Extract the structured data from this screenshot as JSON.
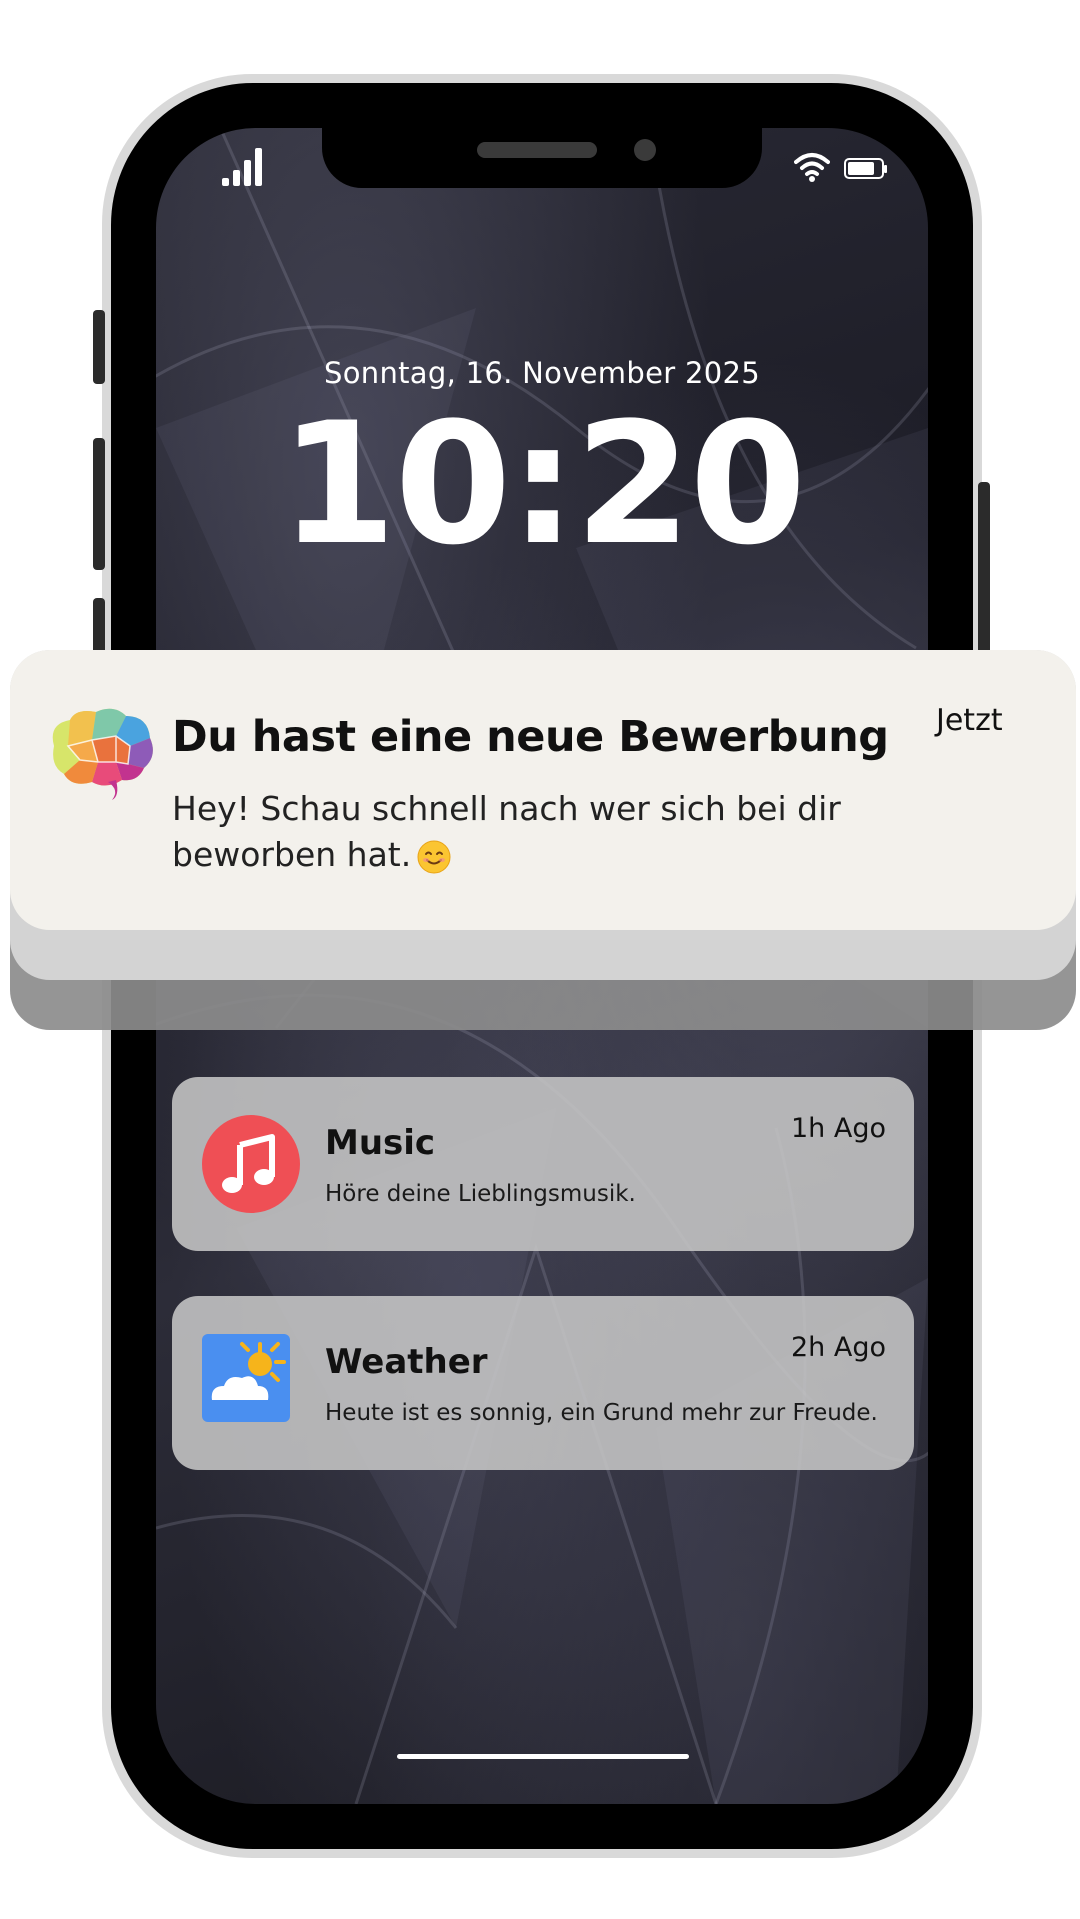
{
  "status_bar": {
    "signal_icon": "cellular-signal-icon",
    "wifi_icon": "wifi-icon",
    "battery_icon": "battery-icon"
  },
  "lock_screen": {
    "date": "Sonntag, 16. November 2025",
    "time": "10:20"
  },
  "main_notification": {
    "app_icon": "brain-logo-icon",
    "title": "Du hast eine neue Bewerbung",
    "time": "Jetzt",
    "body": "Hey! Schau schnell nach wer sich bei dir beworben hat.",
    "emoji": "smiling-face-icon"
  },
  "notifications": [
    {
      "app": "Music",
      "icon": "music-note-icon",
      "text": "Höre deine Lieblingsmusik.",
      "time": "1h Ago"
    },
    {
      "app": "Weather",
      "icon": "sun-cloud-icon",
      "text": "Heute ist es sonnig, ein Grund mehr zur Freude.",
      "time": "2h Ago"
    }
  ],
  "colors": {
    "music_icon_bg": "#ef4f55",
    "weather_icon_bg": "#4a8ff0",
    "notification_bg": "#f3f1ec",
    "card_bg": "#c6c6c6"
  }
}
